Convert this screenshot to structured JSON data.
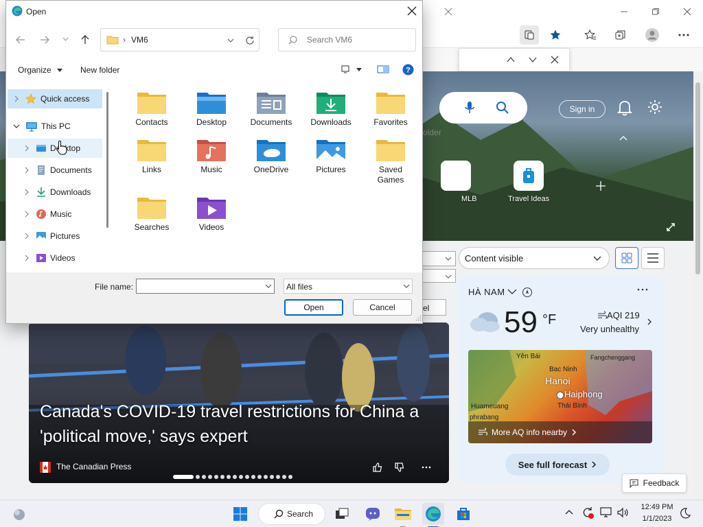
{
  "dialog": {
    "title": "Open",
    "address": {
      "path_segment": "VM6"
    },
    "search": {
      "placeholder": "Search VM6"
    },
    "commands": {
      "organize": "Organize",
      "new_folder": "New folder"
    },
    "nav": [
      {
        "label": "Quick access",
        "icon": "star-icon",
        "level": 0
      },
      {
        "label": "This PC",
        "icon": "monitor-icon",
        "level": 0
      },
      {
        "label": "Desktop",
        "icon": "desktop-folder-icon",
        "level": 1
      },
      {
        "label": "Documents",
        "icon": "documents-icon",
        "level": 1
      },
      {
        "label": "Downloads",
        "icon": "downloads-icon",
        "level": 1
      },
      {
        "label": "Music",
        "icon": "music-icon",
        "level": 1
      },
      {
        "label": "Pictures",
        "icon": "pictures-icon",
        "level": 1
      },
      {
        "label": "Videos",
        "icon": "videos-icon",
        "level": 1
      }
    ],
    "folders": [
      {
        "label": "Contacts",
        "icon": "folder-icon"
      },
      {
        "label": "Desktop",
        "icon": "desktop-folder-icon"
      },
      {
        "label": "Documents",
        "icon": "documents-icon"
      },
      {
        "label": "Downloads",
        "icon": "downloads-icon"
      },
      {
        "label": "Favorites",
        "icon": "folder-icon"
      },
      {
        "label": "Links",
        "icon": "folder-icon"
      },
      {
        "label": "Music",
        "icon": "music-icon"
      },
      {
        "label": "OneDrive",
        "icon": "onedrive-icon"
      },
      {
        "label": "Pictures",
        "icon": "pictures-icon"
      },
      {
        "label": "Saved Games",
        "icon": "folder-icon"
      },
      {
        "label": "Searches",
        "icon": "folder-icon"
      },
      {
        "label": "Videos",
        "icon": "videos-icon"
      }
    ],
    "file_name_label": "File name:",
    "file_name_value": "",
    "file_type": "All files",
    "open_label": "Open",
    "cancel_label": "Cancel"
  },
  "browser": {
    "signin": "Sign in",
    "quick_links": [
      {
        "label": "MLB"
      },
      {
        "label": "Travel Ideas"
      }
    ],
    "behind_text": {
      "folder": "older",
      "cancel": "el"
    },
    "content_visible": "Content visible",
    "news": {
      "headline": "Canada's COVID-19 travel restrictions for China a 'political move,' says expert",
      "source": "The Canadian Press"
    },
    "weather": {
      "location": "HÀ NAM",
      "temperature": "59",
      "unit": "°F",
      "aqi": "AQI 219",
      "aqi_status": "Very unhealthy",
      "map_labels": {
        "yen_bai": "Yên Bái",
        "fangchenggang": "Fangchenggang",
        "bac_ninh": "Bac Ninh",
        "hanoi": "Hanoi",
        "haiphong": "Haiphong",
        "thai_binh": "Thái Bình",
        "huameuang": "Huameuang",
        "phrabang": "phrabang"
      },
      "more_aq": "More AQ info nearby",
      "full_forecast": "See full forecast"
    },
    "feedback": "Feedback"
  },
  "taskbar": {
    "search": "Search",
    "time": "12:49 PM",
    "date": "1/1/2023"
  },
  "colors": {
    "accent": "#0067c0",
    "folder": "#f8d775",
    "edge": "#0c59a4"
  }
}
